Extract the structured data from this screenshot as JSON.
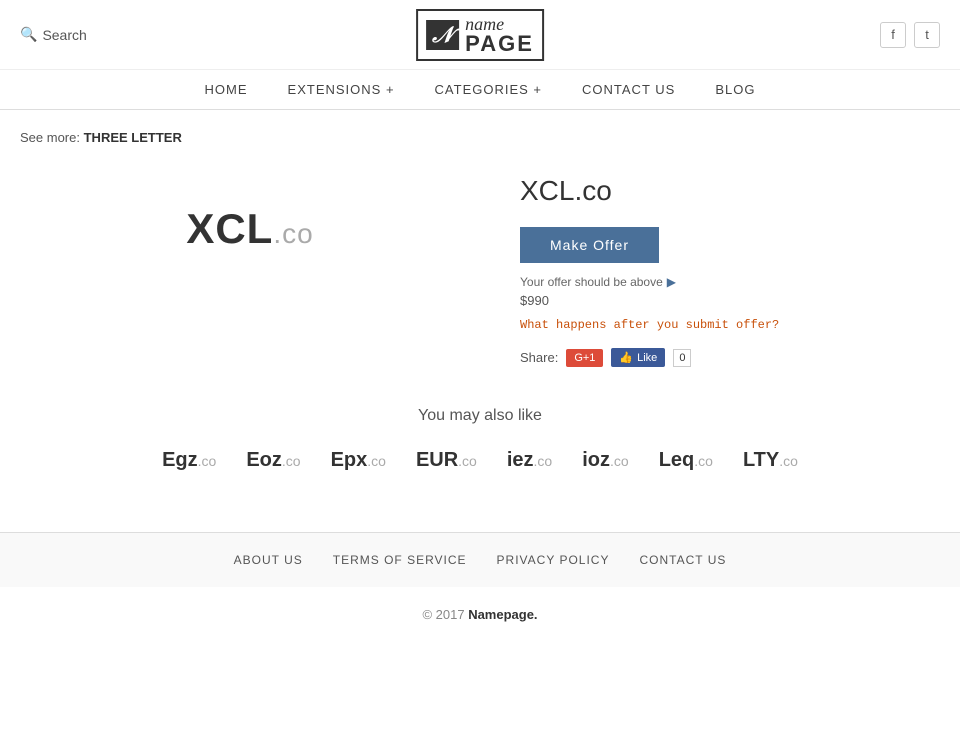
{
  "header": {
    "search_label": "Search",
    "logo_icon": "n",
    "logo_text_top": "name",
    "logo_text_bottom": "PAGE",
    "social": [
      {
        "name": "facebook",
        "icon": "f"
      },
      {
        "name": "twitter",
        "icon": "t"
      }
    ]
  },
  "nav": {
    "items": [
      {
        "id": "home",
        "label": "HOME"
      },
      {
        "id": "extensions",
        "label": "EXTENSIONS +"
      },
      {
        "id": "categories",
        "label": "CATEGORIES +"
      },
      {
        "id": "contact",
        "label": "CONTACT US"
      },
      {
        "id": "blog",
        "label": "BLOG"
      }
    ]
  },
  "breadcrumb": {
    "prefix": "See more:",
    "link_text": "THREE LETTER"
  },
  "domain": {
    "name": "XCL",
    "tld": ".co",
    "full": "XCL.co",
    "title": "XCL.co",
    "offer_btn": "Make Offer",
    "offer_hint": "Your offer should be above",
    "offer_price": "$990",
    "what_happens": "What happens after you submit offer?",
    "share_label": "Share:",
    "gplus_label": "G+1",
    "fb_like_label": "Like",
    "fb_count": "0"
  },
  "also_like": {
    "title": "You may also like",
    "items": [
      {
        "name": "Egz",
        "tld": ".co"
      },
      {
        "name": "Eoz",
        "tld": ".co"
      },
      {
        "name": "Epx",
        "tld": ".co"
      },
      {
        "name": "EUR",
        "tld": ".co"
      },
      {
        "name": "iez",
        "tld": ".co"
      },
      {
        "name": "ioz",
        "tld": ".co"
      },
      {
        "name": "Leq",
        "tld": ".co"
      },
      {
        "name": "LTY",
        "tld": ".co"
      }
    ]
  },
  "footer": {
    "nav_items": [
      {
        "id": "about",
        "label": "ABOUT US"
      },
      {
        "id": "terms",
        "label": "TERMS OF SERVICE"
      },
      {
        "id": "privacy",
        "label": "PRIVACY POLICY"
      },
      {
        "id": "contact",
        "label": "CONTACT US"
      }
    ],
    "copyright": "© 2017",
    "brand": "Namepage."
  }
}
